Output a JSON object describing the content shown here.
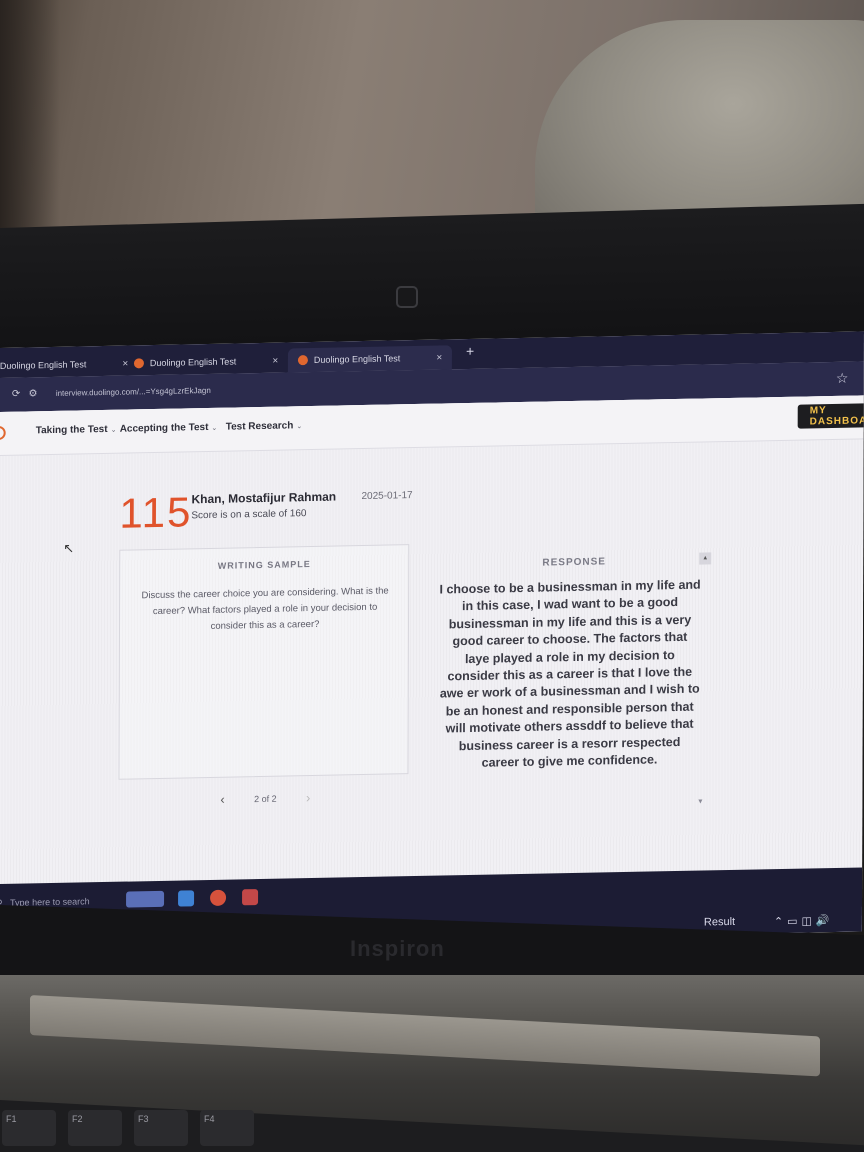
{
  "browser": {
    "tabs": [
      {
        "label": "Duolingo English Test"
      },
      {
        "label": "Duolingo English Test"
      },
      {
        "label": "Duolingo English Test"
      }
    ],
    "new_tab": "+",
    "address": "interview.duolingo.com/...=Ysg4gLzrEkJagn",
    "close_glyph": "×"
  },
  "nav": {
    "items": [
      "Taking the Test",
      "Accepting the Test",
      "Test Research"
    ],
    "chevron": "⌄",
    "dashboard_button": "MY DASHBOARD"
  },
  "candidate": {
    "score": "115",
    "name": "Khan, Mostafijur Rahman",
    "scale_note": "Score is on a scale of 160",
    "date": "2025-01-17"
  },
  "writing_sample": {
    "heading": "WRITING SAMPLE",
    "prompt": "Discuss the career choice you are considering. What is the career? What factors played a role in your decision to consider this as a career?"
  },
  "response": {
    "heading": "RESPONSE",
    "text": "I choose to be a businessman in my life and in this case, I wad want to be a good businessman in my life and this is a very good career to choose. The factors that laye played a role in my decision to consider this as a career is that I love the awe er work of a businessman and I wish to be an honest and responsible person that will motivate others assddf to believe that business career is a resorr respected career to give me confidence."
  },
  "pager": {
    "prev": "‹",
    "label": "2 of 2",
    "next": "›"
  },
  "taskbar": {
    "search_placeholder": "Type here to search",
    "result_label": "Result"
  },
  "laptop": {
    "brand": "Inspiron",
    "keys": [
      "F1",
      "F2",
      "F3",
      "F4"
    ]
  }
}
